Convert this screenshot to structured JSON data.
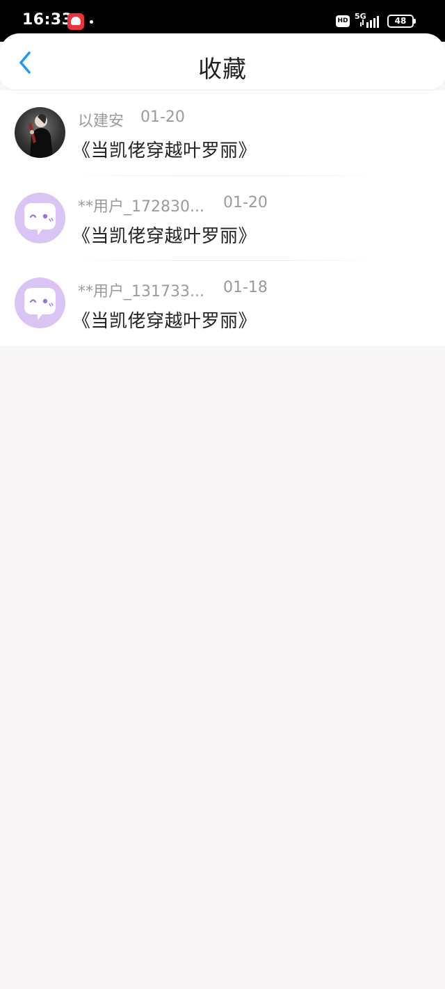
{
  "status_bar": {
    "time": "16:33",
    "hd": "HD",
    "network": "5G",
    "battery": "48"
  },
  "header": {
    "title": "收藏"
  },
  "items": [
    {
      "username": "以建安",
      "date": "01-20",
      "title": "《当凯佬穿越叶罗丽》",
      "avatar": "photo"
    },
    {
      "username": "**用户_172830...",
      "date": "01-20",
      "title": "《当凯佬穿越叶罗丽》",
      "avatar": "default"
    },
    {
      "username": "**用户_131733...",
      "date": "01-18",
      "title": "《当凯佬穿越叶罗丽》",
      "avatar": "default"
    }
  ],
  "colors": {
    "accent": "#2196f3",
    "avatar_default_bg": "#d9c4f4",
    "avatar_default_fg": "#9d74d9"
  }
}
